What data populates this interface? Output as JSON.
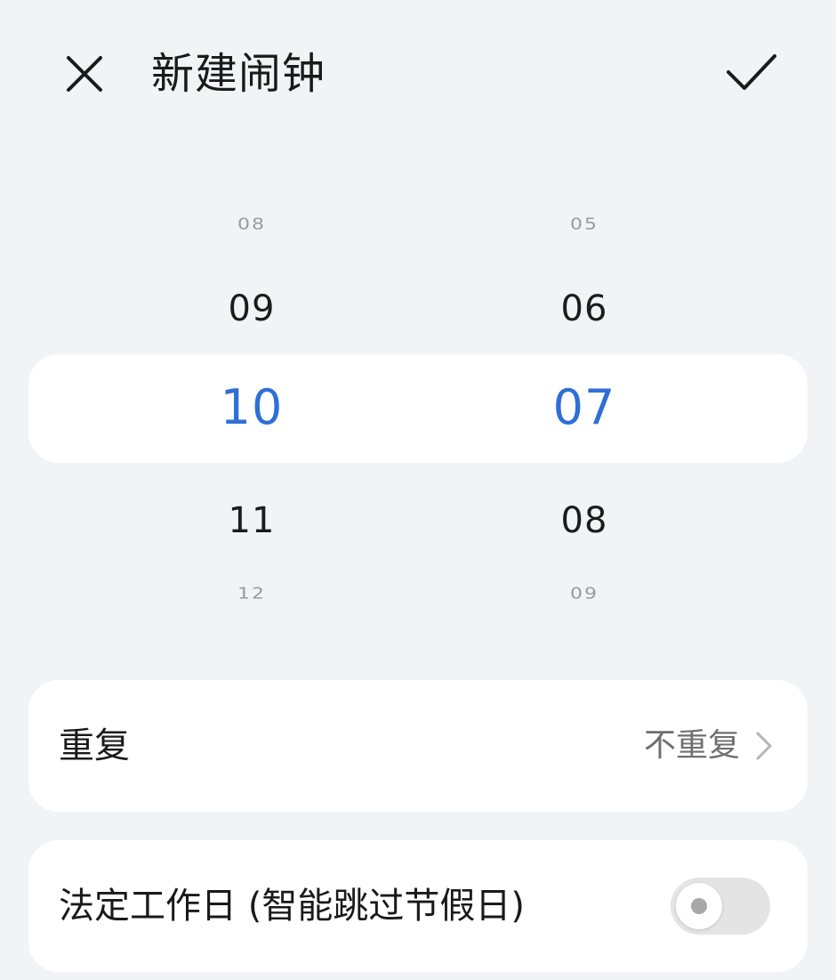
{
  "header": {
    "title": "新建闹钟",
    "close_icon": "close-icon",
    "confirm_icon": "checkmark-icon"
  },
  "time_picker": {
    "hours": {
      "items": [
        "08",
        "09",
        "10",
        "11",
        "12"
      ],
      "selected": "10"
    },
    "minutes": {
      "items": [
        "05",
        "06",
        "07",
        "08",
        "09"
      ],
      "selected": "07"
    },
    "accent_color": "#2f6fd6"
  },
  "settings": {
    "repeat": {
      "label": "重复",
      "value": "不重复",
      "icon": "chevron-right-icon"
    },
    "workday": {
      "label": "法定工作日 (智能跳过节假日)",
      "enabled": false
    }
  }
}
